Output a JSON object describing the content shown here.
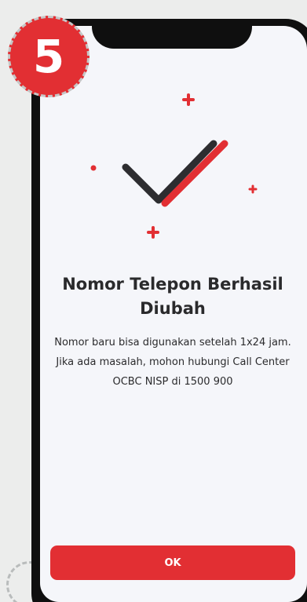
{
  "step_badge": {
    "number": "5"
  },
  "success": {
    "title": "Nomor Telepon Berhasil Diubah",
    "message": "Nomor baru bisa digunakan setelah 1x24 jam. Jika ada masalah, mohon hubungi Call Center OCBC NISP di 1500 900",
    "illustration": "checkmark-icon"
  },
  "actions": {
    "ok_label": "OK"
  },
  "colors": {
    "accent": "#e22f33",
    "dark": "#2a2a2c",
    "screen_bg": "#f5f6fa"
  }
}
